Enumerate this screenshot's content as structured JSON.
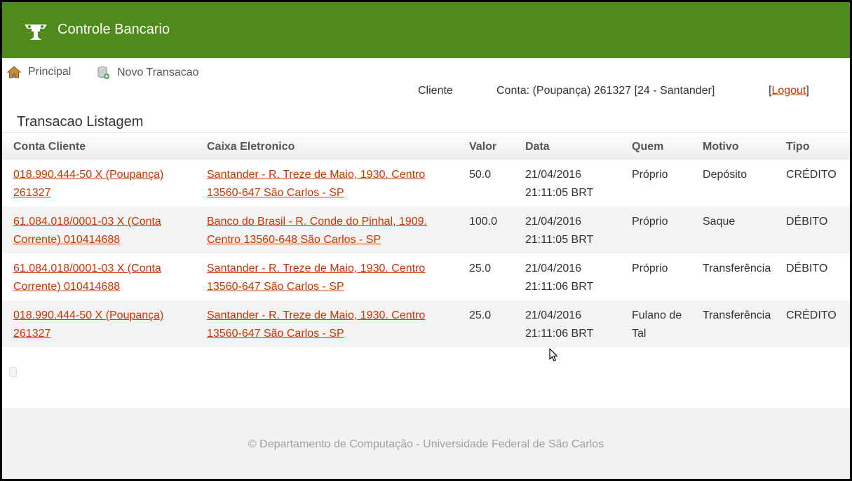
{
  "app": {
    "title": "Controle Bancario",
    "logo_icon": "bank-logo-icon"
  },
  "nav": {
    "principal": {
      "label": "Principal",
      "icon": "home-icon"
    },
    "novo": {
      "label": "Novo Transacao",
      "icon": "new-record-icon"
    }
  },
  "user": {
    "cliente": "Cliente",
    "conta": "Conta: (Poupança) 261327 [24 - Santander]",
    "logout_open": "[",
    "logout": "Logout",
    "logout_close": "]"
  },
  "list": {
    "title": "Transacao Listagem",
    "columns": [
      "Conta Cliente",
      "Caixa Eletronico",
      "Valor",
      "Data",
      "Quem",
      "Motivo",
      "Tipo"
    ],
    "rows": [
      {
        "conta_cliente": "018.990.444-50 X (Poupança) 261327",
        "caixa": "Santander - R. Treze de Maio, 1930. Centro 13560-647 São Carlos - SP",
        "valor": "50.0",
        "data": "21/04/2016 21:11:05 BRT",
        "quem": "Próprio",
        "motivo": "Depósito",
        "tipo": "CRÉDITO"
      },
      {
        "conta_cliente": "61.084.018/0001-03 X (Conta Corrente) 010414688",
        "caixa": "Banco do Brasil - R. Conde do Pinhal, 1909. Centro 13560-648 São Carlos - SP",
        "valor": "100.0",
        "data": "21/04/2016 21:11:05 BRT",
        "quem": "Próprio",
        "motivo": "Saque",
        "tipo": "DÉBITO"
      },
      {
        "conta_cliente": "61.084.018/0001-03 X (Conta Corrente) 010414688",
        "caixa": "Santander - R. Treze de Maio, 1930. Centro 13560-647 São Carlos - SP",
        "valor": "25.0",
        "data": "21/04/2016 21:11:06 BRT",
        "quem": "Próprio",
        "motivo": "Transferência",
        "tipo": "DÉBITO"
      },
      {
        "conta_cliente": "018.990.444-50 X (Poupança) 261327",
        "caixa": "Santander - R. Treze de Maio, 1930. Centro 13560-647 São Carlos - SP",
        "valor": "25.0",
        "data": "21/04/2016 21:11:06 BRT",
        "quem": "Fulano de Tal",
        "motivo": "Transferência",
        "tipo": "CRÉDITO"
      }
    ]
  },
  "footer": {
    "text": "© Departamento de Computação - Universidade Federal de São Carlos"
  },
  "colors": {
    "header": "#4f8a1c",
    "link": "#cc3300",
    "footer_bg": "#f2f2f2"
  }
}
